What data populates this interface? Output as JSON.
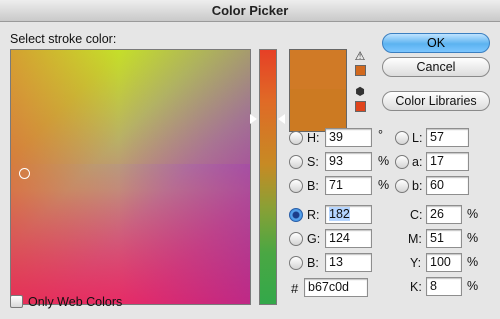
{
  "window": {
    "title": "Color Picker"
  },
  "prompt": "Select stroke color:",
  "colors": {
    "new_swatch": "#d07a26",
    "current_swatch": "#cc7a22",
    "warning_chip": "#d2691e",
    "cube_chip": "#e0441c",
    "accent": "#5cb3f0"
  },
  "buttons": {
    "ok": "OK",
    "cancel": "Cancel",
    "libraries": "Color Libraries"
  },
  "icons": {
    "gamut_warning": "warning-triangle-icon",
    "web_safe": "cube-icon"
  },
  "hsb": {
    "h": {
      "label": "H:",
      "value": "39",
      "unit": "°"
    },
    "s": {
      "label": "S:",
      "value": "93",
      "unit": "%"
    },
    "b": {
      "label": "B:",
      "value": "71",
      "unit": "%"
    }
  },
  "rgb": {
    "r": {
      "label": "R:",
      "value": "182"
    },
    "g": {
      "label": "G:",
      "value": "124"
    },
    "b": {
      "label": "B:",
      "value": "13"
    }
  },
  "lab": {
    "l": {
      "label": "L:",
      "value": "57"
    },
    "a": {
      "label": "a:",
      "value": "17"
    },
    "b": {
      "label": "b:",
      "value": "60"
    }
  },
  "cmyk": {
    "c": {
      "label": "C:",
      "value": "26",
      "unit": "%"
    },
    "m": {
      "label": "M:",
      "value": "51",
      "unit": "%"
    },
    "y": {
      "label": "Y:",
      "value": "100",
      "unit": "%"
    },
    "k": {
      "label": "K:",
      "value": "8",
      "unit": "%"
    }
  },
  "hex": {
    "label": "#",
    "value": "b67c0d"
  },
  "selected_mode": "R",
  "web_colors": {
    "label": "Only Web Colors",
    "checked": false
  }
}
